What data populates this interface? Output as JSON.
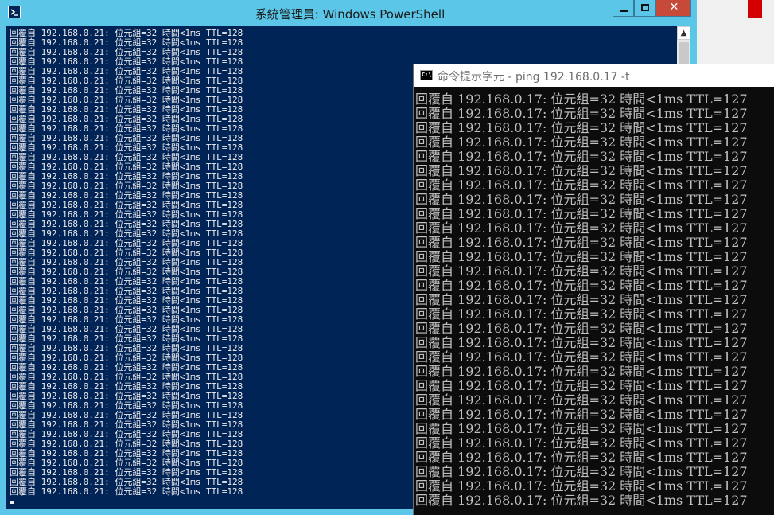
{
  "powershell": {
    "title": "系統管理員: Windows PowerShell",
    "close_label": "✕",
    "scroll_up_glyph": "▲",
    "line_text": "回覆自 192.168.0.21: 位元組=32 時間<1ms TTL=128",
    "line_count": 49
  },
  "cmd": {
    "title": "命令提示字元 - ping  192.168.0.17 -t",
    "icon_text": "C:\\",
    "line_text": "回覆自 192.168.0.17: 位元組=32 時間<1ms TTL=127",
    "line_count": 29
  },
  "colors": {
    "powershell_bg": "#012456",
    "powershell_title_bar": "#5bc6e8",
    "cmd_bg": "#0c0c0c",
    "cmd_text": "#c0c0c0",
    "close_button": "#c7493a"
  }
}
